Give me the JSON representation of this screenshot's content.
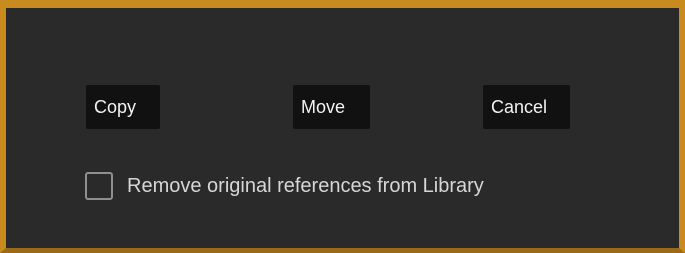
{
  "dialog": {
    "buttons": {
      "copy_label": "Copy",
      "move_label": "Move",
      "cancel_label": "Cancel"
    },
    "option": {
      "checked": false,
      "label": "Remove original references from Library"
    }
  },
  "colors": {
    "background": "#2a2a2a",
    "frame_accent": "#c98a1e",
    "button_bg": "#111111",
    "button_text": "#f2f2f2",
    "label_text": "#d6d6d6"
  }
}
